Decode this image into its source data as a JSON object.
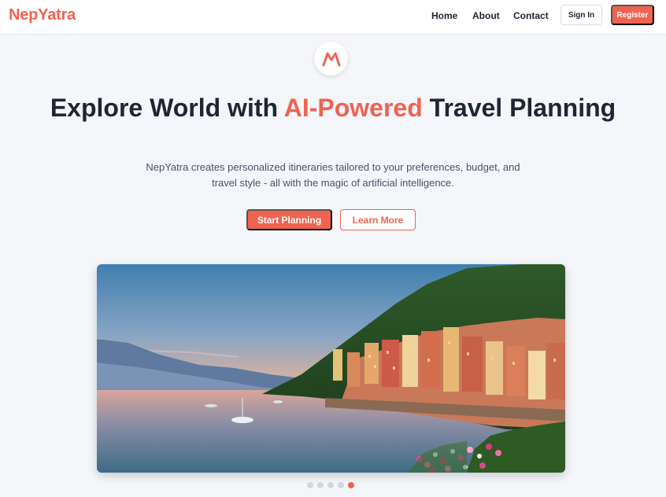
{
  "nav": {
    "brand": "NepYatra",
    "links": [
      "Home",
      "About",
      "Contact"
    ],
    "signin_label": "Sign In",
    "register_label": "Register"
  },
  "hero": {
    "logo_icon": "mountain-icon",
    "title_part1": "Explore World with ",
    "title_accent": "AI-Powered",
    "title_part2": " Travel Planning",
    "subtitle": "NepYatra creates personalized itineraries tailored to your preferences, budget, and travel style - all with the magic of artificial intelligence.",
    "start_label": "Start Planning",
    "learn_label": "Learn More"
  },
  "carousel": {
    "slide_count": 5,
    "active_index": 4
  },
  "colors": {
    "accent": "#ef6351",
    "text": "#1e2533"
  }
}
